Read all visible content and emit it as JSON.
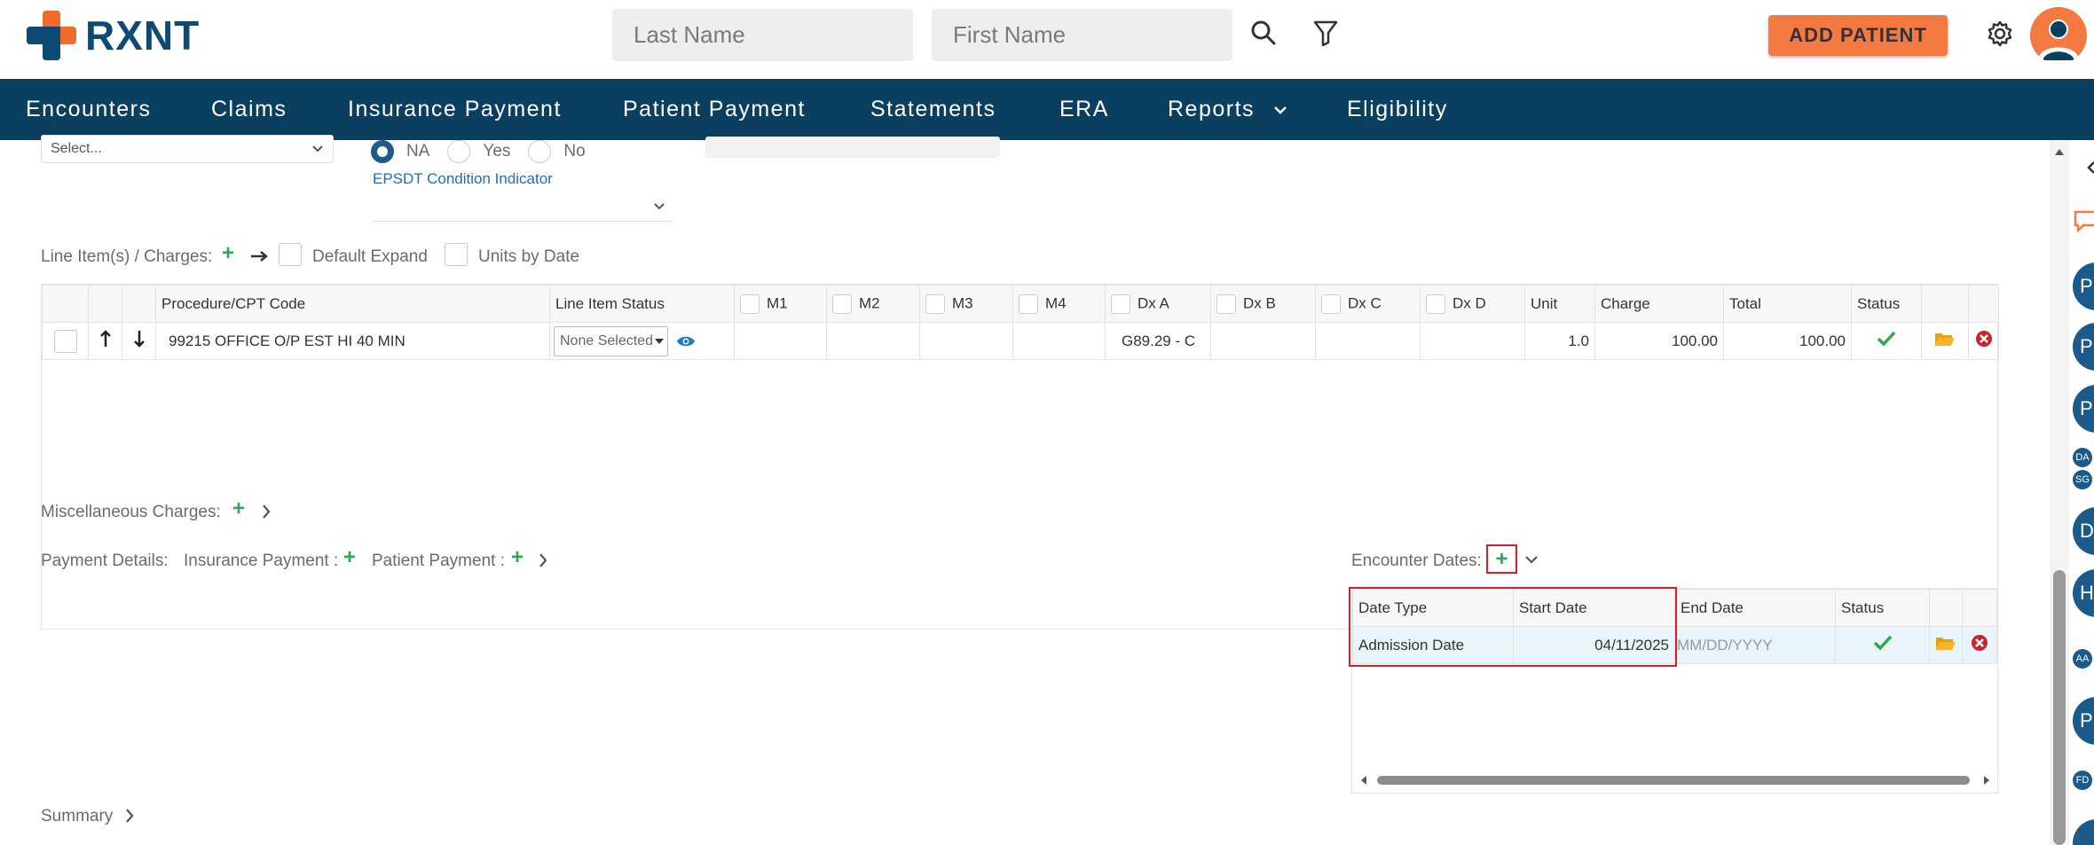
{
  "header": {
    "logo_text": "RXNT",
    "last_name_placeholder": "Last Name",
    "first_name_placeholder": "First Name",
    "add_patient_label": "ADD PATIENT"
  },
  "nav": {
    "items": [
      {
        "label": "Encounters"
      },
      {
        "label": "Claims"
      },
      {
        "label": "Insurance Payment"
      },
      {
        "label": "Patient Payment"
      },
      {
        "label": "Statements"
      },
      {
        "label": "ERA"
      },
      {
        "label": "Reports"
      },
      {
        "label": "Eligibility"
      }
    ]
  },
  "top_form": {
    "select_placeholder": "Select...",
    "radio_options": [
      "NA",
      "Yes",
      "No"
    ],
    "selected_radio": "NA",
    "epsdt_label": "EPSDT Condition Indicator"
  },
  "line_items": {
    "section_label": "Line Item(s) / Charges:",
    "default_expand_label": "Default Expand",
    "units_by_date_label": "Units by Date",
    "columns": [
      "Procedure/CPT Code",
      "Line Item Status",
      "M1",
      "M2",
      "M3",
      "M4",
      "Dx A",
      "Dx B",
      "Dx C",
      "Dx D",
      "Unit",
      "Charge",
      "Total",
      "Status"
    ],
    "rows": [
      {
        "procedure": "99215 OFFICE O/P EST HI 40 MIN",
        "line_item_status": "None Selected",
        "m1": "",
        "m2": "",
        "m3": "",
        "m4": "",
        "dx_a": "G89.29 - C",
        "dx_b": "",
        "dx_c": "",
        "dx_d": "",
        "unit": "1.0",
        "charge": "100.00",
        "total": "100.00"
      }
    ]
  },
  "misc": {
    "label": "Miscellaneous Charges:"
  },
  "payment": {
    "label": "Payment Details:",
    "insurance_label": "Insurance Payment :",
    "patient_label": "Patient Payment :"
  },
  "encounter_dates": {
    "label": "Encounter Dates:",
    "columns": [
      "Date Type",
      "Start Date",
      "End Date",
      "Status"
    ],
    "rows": [
      {
        "date_type": "Admission Date",
        "start_date": "04/11/2025",
        "end_date_placeholder": "MM/DD/YYYY"
      }
    ]
  },
  "summary": {
    "label": "Summary"
  },
  "side_rail": {
    "circles": [
      "P",
      "P",
      "P",
      "DA",
      "HS",
      "P"
    ],
    "smalls": [
      "DA",
      "SG",
      "AA",
      "FD"
    ]
  },
  "colors": {
    "nav_bg": "#0a3f60",
    "brand_orange": "#f47a42",
    "green": "#2fa84f",
    "highlight_red": "#d22027"
  }
}
